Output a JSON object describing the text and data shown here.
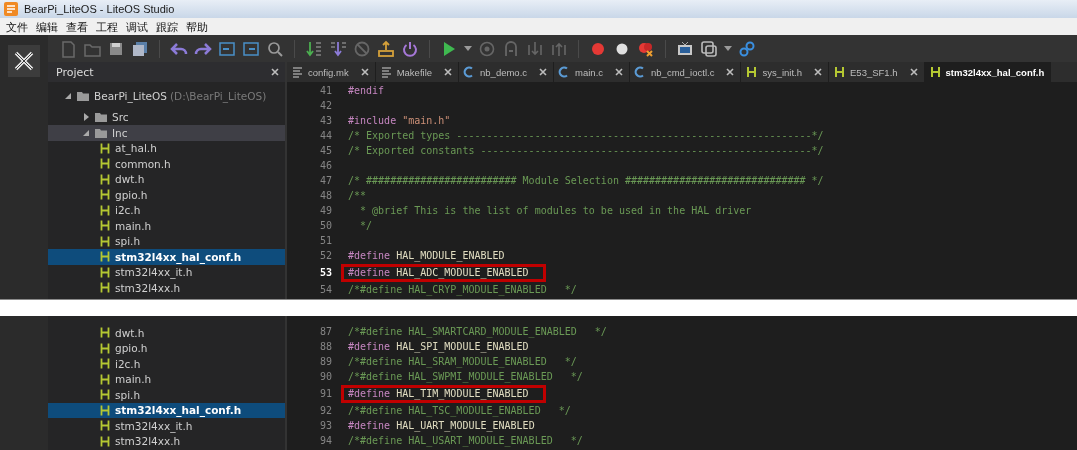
{
  "screenshots": [
    {
      "window": {
        "title": "BearPi_LiteOS - LiteOS Studio"
      },
      "menu": [
        "文件",
        "编辑",
        "查看",
        "工程",
        "调试",
        "跟踪",
        "帮助"
      ],
      "project": {
        "title": "Project",
        "tree": [
          {
            "name": "BearPi_LiteOS",
            "path": "(D:\\BearPi_LiteOS)",
            "kind": "project",
            "expanded": true,
            "selected": false,
            "children": [
              {
                "name": "Src",
                "kind": "folder",
                "expanded": false,
                "selected": false
              },
              {
                "name": "Inc",
                "kind": "folder",
                "expanded": true,
                "selected": false,
                "highlighted": true,
                "children": [
                  {
                    "name": "at_hal.h",
                    "kind": "header",
                    "selected": false
                  },
                  {
                    "name": "common.h",
                    "kind": "header",
                    "selected": false
                  },
                  {
                    "name": "dwt.h",
                    "kind": "header",
                    "selected": false
                  },
                  {
                    "name": "gpio.h",
                    "kind": "header",
                    "selected": false
                  },
                  {
                    "name": "i2c.h",
                    "kind": "header",
                    "selected": false
                  },
                  {
                    "name": "main.h",
                    "kind": "header",
                    "selected": false
                  },
                  {
                    "name": "spi.h",
                    "kind": "header",
                    "selected": false
                  },
                  {
                    "name": "stm32l4xx_hal_conf.h",
                    "kind": "header",
                    "selected": true
                  },
                  {
                    "name": "stm32l4xx_it.h",
                    "kind": "header",
                    "selected": false
                  },
                  {
                    "name": "stm32l4xx.h",
                    "kind": "header",
                    "selected": false
                  }
                ]
              }
            ]
          }
        ]
      },
      "tabs": [
        {
          "label": "config.mk",
          "kind": "text",
          "selected": false
        },
        {
          "label": "Makefile",
          "kind": "text",
          "selected": false
        },
        {
          "label": "nb_demo.c",
          "kind": "c",
          "selected": false
        },
        {
          "label": "main.c",
          "kind": "c",
          "selected": false
        },
        {
          "label": "nb_cmd_ioctl.c",
          "kind": "c",
          "selected": false
        },
        {
          "label": "sys_init.h",
          "kind": "h",
          "selected": false
        },
        {
          "label": "E53_SF1.h",
          "kind": "h",
          "selected": false
        },
        {
          "label": "stm32l4xx_hal_conf.h",
          "kind": "h",
          "selected": true
        }
      ],
      "code": [
        {
          "number": "41",
          "tokens": [
            {
              "kind": "directive",
              "text": "#endif"
            }
          ]
        },
        {
          "number": "42"
        },
        {
          "number": "43",
          "tokens": [
            {
              "kind": "directive",
              "text": "#include"
            },
            {
              "kind": "string",
              "text": " \"main.h\""
            }
          ]
        },
        {
          "number": "44",
          "tokens": [
            {
              "kind": "comment",
              "text": "/* Exported types -----------------------------------------------------------*/"
            }
          ]
        },
        {
          "number": "45",
          "tokens": [
            {
              "kind": "comment",
              "text": "/* Exported constants -------------------------------------------------------*/"
            }
          ]
        },
        {
          "number": "46"
        },
        {
          "number": "47",
          "tokens": [
            {
              "kind": "comment",
              "text": "/* ######################### Module Selection ############################## */"
            }
          ]
        },
        {
          "number": "48",
          "tokens": [
            {
              "kind": "comment",
              "text": "/**"
            }
          ]
        },
        {
          "number": "49",
          "tokens": [
            {
              "kind": "comment",
              "text": "  * @brief This is the list of modules to be used in the HAL driver"
            }
          ]
        },
        {
          "number": "50",
          "tokens": [
            {
              "kind": "comment",
              "text": "  */"
            }
          ]
        },
        {
          "number": "51"
        },
        {
          "number": "52",
          "tokens": [
            {
              "kind": "directive",
              "text": "#define"
            },
            {
              "kind": "macro",
              "text": " HAL_MODULE_ENABLED"
            }
          ]
        },
        {
          "number": "53",
          "current": true,
          "highlight": true,
          "tokens": [
            {
              "kind": "directive",
              "text": "#define"
            },
            {
              "kind": "macro",
              "text": " HAL_ADC_MODULE_ENABLED"
            }
          ]
        },
        {
          "number": "54",
          "tokens": [
            {
              "kind": "comment",
              "text": "/*#define HAL_CRYP_MODULE_ENABLED   */"
            }
          ]
        }
      ]
    },
    {
      "project": {
        "tree": [
          {
            "name": "dwt.h",
            "kind": "header",
            "selected": false
          },
          {
            "name": "gpio.h",
            "kind": "header",
            "selected": false
          },
          {
            "name": "i2c.h",
            "kind": "header",
            "selected": false
          },
          {
            "name": "main.h",
            "kind": "header",
            "selected": false
          },
          {
            "name": "spi.h",
            "kind": "header",
            "selected": false
          },
          {
            "name": "stm32l4xx_hal_conf.h",
            "kind": "header",
            "selected": true
          },
          {
            "name": "stm32l4xx_it.h",
            "kind": "header",
            "selected": false
          },
          {
            "name": "stm32l4xx.h",
            "kind": "header",
            "selected": false
          }
        ]
      },
      "code": [
        {
          "number": "87",
          "tokens": [
            {
              "kind": "comment",
              "text": "/*#define HAL_SMARTCARD_MODULE_ENABLED   */"
            }
          ]
        },
        {
          "number": "88",
          "tokens": [
            {
              "kind": "directive",
              "text": "#define"
            },
            {
              "kind": "macro",
              "text": " HAL_SPI_MODULE_ENABLED"
            }
          ]
        },
        {
          "number": "89",
          "tokens": [
            {
              "kind": "comment",
              "text": "/*#define HAL_SRAM_MODULE_ENABLED   */"
            }
          ]
        },
        {
          "number": "90",
          "tokens": [
            {
              "kind": "comment",
              "text": "/*#define HAL_SWPMI_MODULE_ENABLED   */"
            }
          ]
        },
        {
          "number": "91",
          "highlight": true,
          "tokens": [
            {
              "kind": "directive",
              "text": "#define"
            },
            {
              "kind": "macro",
              "text": " HAL_TIM_MODULE_ENABLED"
            }
          ]
        },
        {
          "number": "92",
          "tokens": [
            {
              "kind": "comment",
              "text": "/*#define HAL_TSC_MODULE_ENABLED   */"
            }
          ]
        },
        {
          "number": "93",
          "tokens": [
            {
              "kind": "directive",
              "text": "#define"
            },
            {
              "kind": "macro",
              "text": " HAL_UART_MODULE_ENABLED"
            }
          ]
        },
        {
          "number": "94",
          "tokens": [
            {
              "kind": "comment",
              "text": "/*#define HAL_USART_MODULE_ENABLED   */"
            }
          ]
        }
      ]
    }
  ]
}
